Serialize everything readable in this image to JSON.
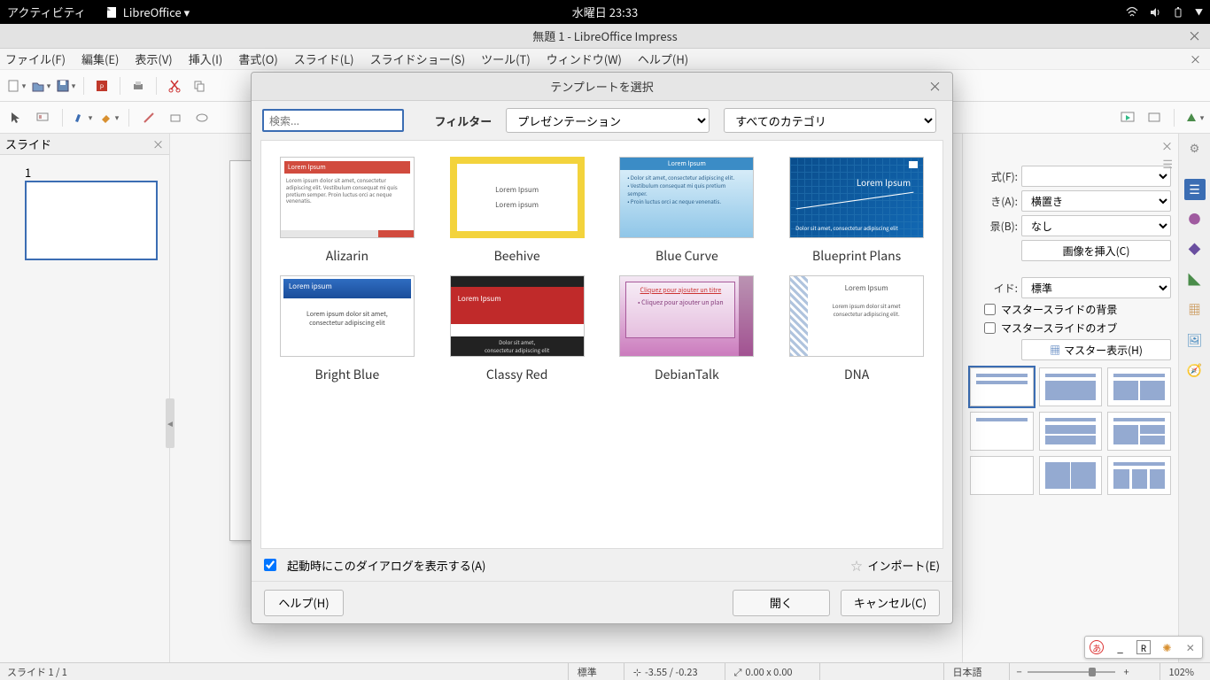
{
  "gnome": {
    "activities": "アクティビティ",
    "app": "LibreOffice ▾",
    "clock": "水曜日 23:33"
  },
  "window": {
    "title": "無題 1 - LibreOffice Impress"
  },
  "menubar": [
    "ファイル(F)",
    "編集(E)",
    "表示(V)",
    "挿入(I)",
    "書式(O)",
    "スライド(L)",
    "スライドショー(S)",
    "ツール(T)",
    "ウィンドウ(W)",
    "ヘルプ(H)"
  ],
  "slides_panel": {
    "title": "スライド",
    "current_num": "1"
  },
  "props": {
    "format_label": "式(F):",
    "orient_label": "き(A):",
    "orient_value": "横置き",
    "bg_label": "景(B):",
    "bg_value": "なし",
    "insert_image_btn": "画像を挿入(C)",
    "master_label": "イド:",
    "master_value": "標準",
    "chk1": "マスタースライドの背景",
    "chk2": "マスタースライドのオブ",
    "master_view_btn": "マスター表示(H)"
  },
  "dialog": {
    "title": "テンプレートを選択",
    "search_placeholder": "検索...",
    "filter_label": "フィルター",
    "filter_type": "プレゼンテーション",
    "filter_cat": "すべてのカテゴリ",
    "templates": [
      "Alizarin",
      "Beehive",
      "Blue Curve",
      "Blueprint Plans",
      "Bright Blue",
      "Classy Red",
      "DebianTalk",
      "DNA"
    ],
    "chk_startup": "起動時にこのダイアログを表示する(A)",
    "import": "インポート(E)",
    "help": "ヘルプ(H)",
    "open": "開く",
    "cancel": "キャンセル(C)"
  },
  "status": {
    "slide_info": "スライド 1 / 1",
    "style": "標準",
    "coords": "-3.55 / -0.23",
    "size": "0.00 x 0.00",
    "lang": "日本語",
    "zoom": "102%"
  },
  "thumb_text": {
    "alizarin_title": "Lorem Ipsum",
    "alizarin_body": "Lorem ipsum dolor sit amet, consectetur adipiscing elit. Vestibulum consequat mi quis pretium semper. Proin luctus orci ac neque venenatis.",
    "beehive_title": "Lorem Ipsum",
    "beehive_sub": "Lorem ipsum",
    "bluecurve_title": "Lorem Ipsum",
    "bluecurve_body": "• Dolor sit amet, consectetur adipiscing elit.\n• Vestibulum consequat mi quis pretium semper.\n• Proin luctus orci ac neque venenatis.",
    "blueprint_title": "Lorem Ipsum",
    "blueprint_footer": "Dolor sit amet, consectetur adipiscing elit",
    "brightblue_title": "Lorem ipsum",
    "brightblue_body": "Lorem ipsum dolor sit amet,\nconsectetur adipiscing elit",
    "classyred_title": "Lorem Ipsum",
    "classyred_sub": "Dolor sit amet,\nconsectetur adipiscing elit",
    "debiantalk_l1": "Cliquez pour ajouter un titre",
    "debiantalk_l2": "• Cliquez pour ajouter un plan",
    "dna_title": "Lorem Ipsum",
    "dna_sub": "Lorem ipsum dolor sit amet\nconsectetur adipiscing elit."
  }
}
